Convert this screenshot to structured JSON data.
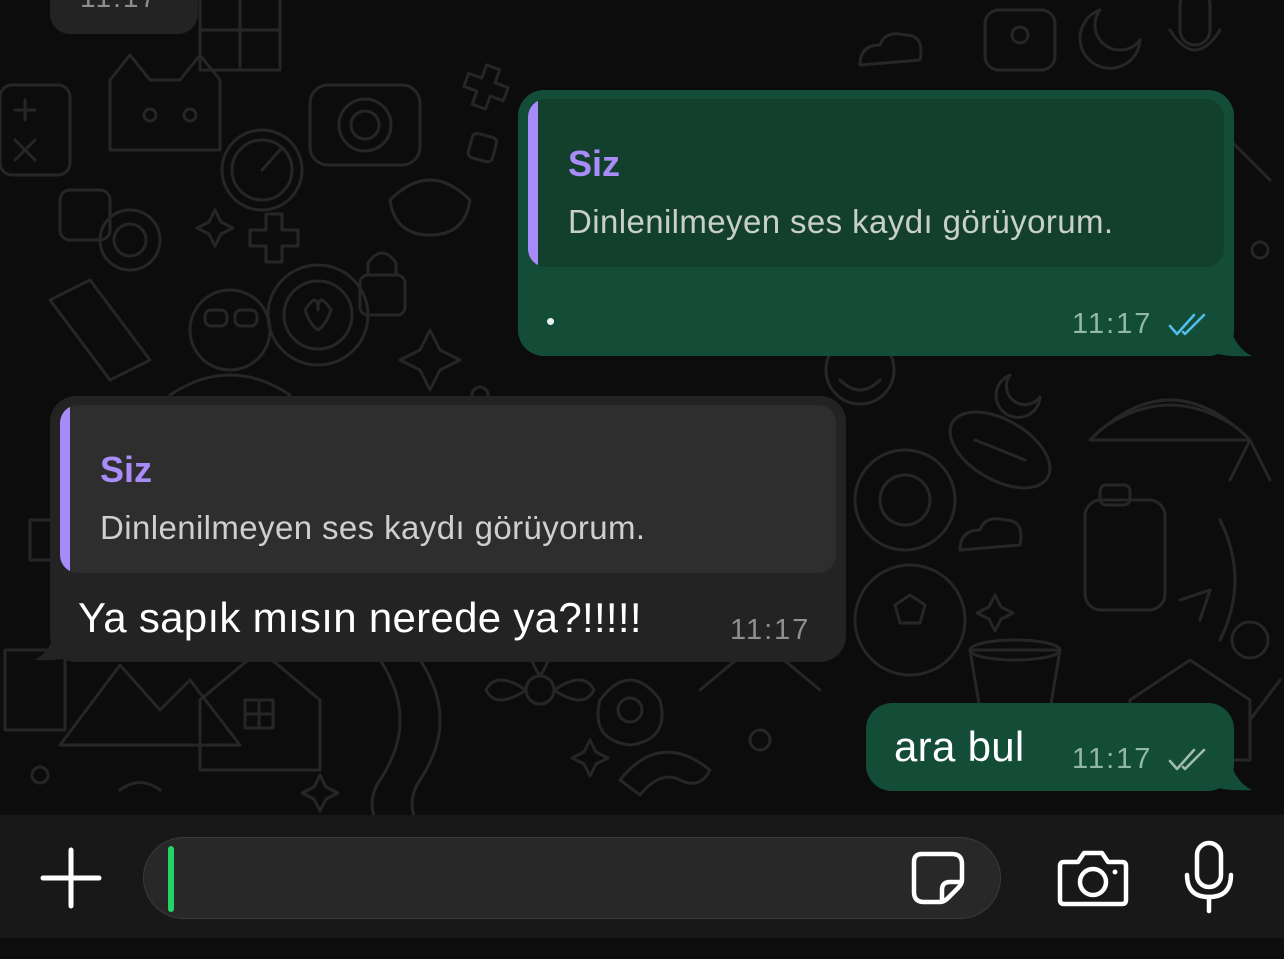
{
  "chat": {
    "previous_message": {
      "time": "11:17"
    },
    "messages": [
      {
        "direction": "outgoing",
        "quote": {
          "author": "Siz",
          "text": "Dinlenilmeyen ses kaydı görüyorum."
        },
        "text": "•",
        "time": "11:17",
        "status": "read",
        "status_icon": "double-check-icon"
      },
      {
        "direction": "incoming",
        "quote": {
          "author": "Siz",
          "text": "Dinlenilmeyen ses kaydı görüyorum."
        },
        "text": "Ya sapık mısın nerede ya?!!!!!",
        "time": "11:17"
      },
      {
        "direction": "outgoing",
        "text": "ara bul",
        "time": "11:17",
        "status": "delivered",
        "status_icon": "double-check-icon"
      }
    ]
  },
  "composer": {
    "value": "",
    "placeholder": "",
    "attach_icon": "plus-icon",
    "sticker_icon": "sticker-icon",
    "camera_icon": "camera-icon",
    "mic_icon": "microphone-icon"
  },
  "colors": {
    "outgoing_bubble": "#134d37",
    "incoming_bubble": "#232323",
    "quote_author": "#a98cf9",
    "read_ticks": "#53bdeb",
    "caret": "#24d366"
  }
}
